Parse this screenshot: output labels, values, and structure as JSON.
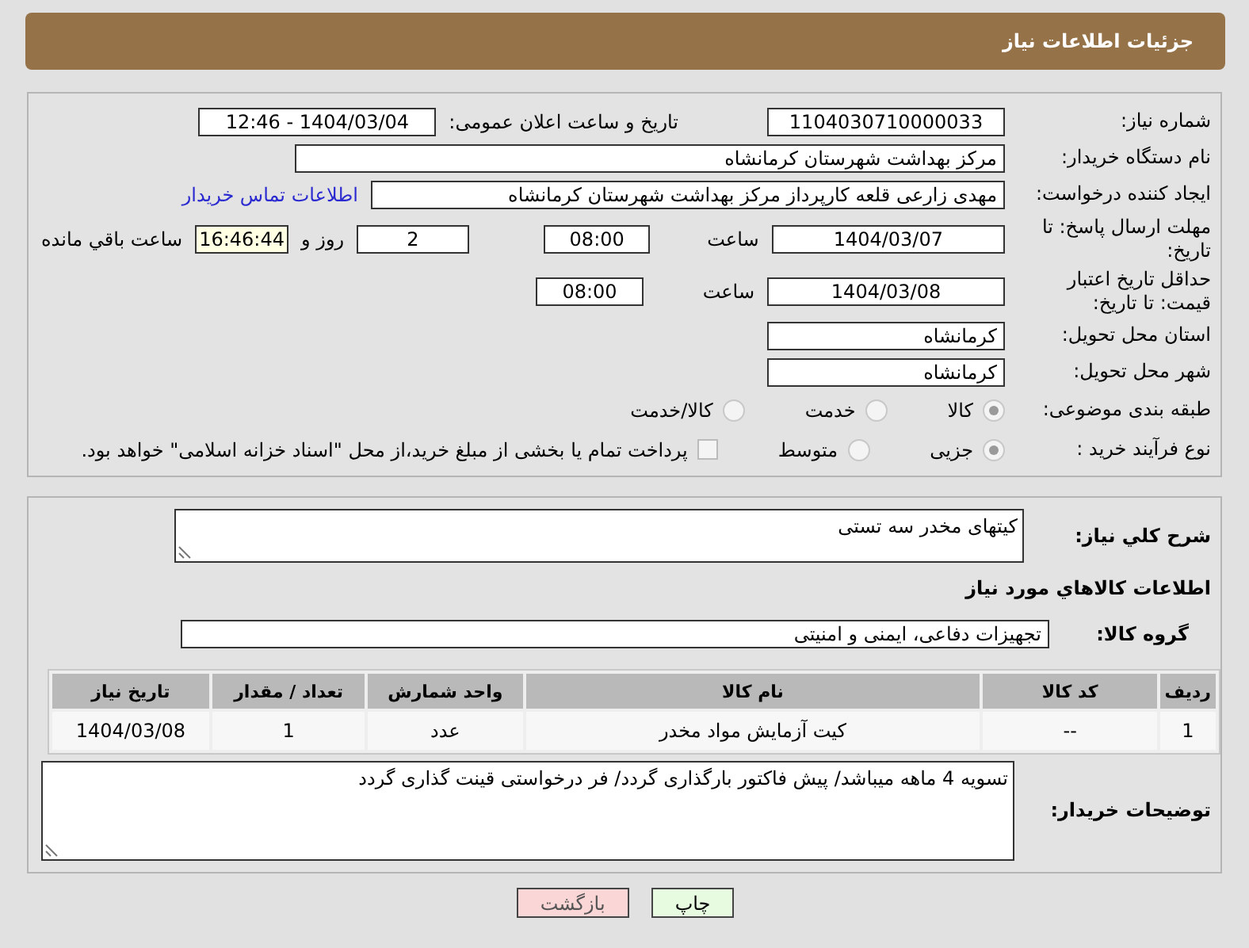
{
  "header": {
    "title": "جزئیات اطلاعات نیاز"
  },
  "need_number": {
    "label": "شماره نیاز:",
    "value": "1104030710000033"
  },
  "announce": {
    "label": "تاریخ و ساعت اعلان عمومی:",
    "value": "1404/03/04 - 12:46"
  },
  "buyer": {
    "label": "نام دستگاه خریدار:",
    "value": "مرکز بهداشت شهرستان کرمانشاه"
  },
  "creator": {
    "label": "ایجاد کننده درخواست:",
    "value": "مهدی  زارعی قلعه کارپرداز مرکز بهداشت شهرستان کرمانشاه",
    "link": "اطلاعات تماس خریدار"
  },
  "deadline": {
    "label": "مهلت ارسال پاسخ: تا تاریخ:",
    "date": "1404/03/07",
    "time_label": "ساعت",
    "time": "08:00",
    "days": "2",
    "days_label": "روز و",
    "remaining": "16:46:44",
    "remaining_label": "ساعت باقي مانده"
  },
  "validity": {
    "label": "حداقل تاریخ اعتبار قیمت: تا تاریخ:",
    "date": "1404/03/08",
    "time_label": "ساعت",
    "time": "08:00"
  },
  "province": {
    "label": "استان محل تحویل:",
    "value": "کرمانشاه"
  },
  "city": {
    "label": "شهر محل تحویل:",
    "value": "کرمانشاه"
  },
  "category": {
    "label": "طبقه بندی موضوعی:",
    "options": [
      {
        "label": "کالا",
        "selected": true
      },
      {
        "label": "خدمت",
        "selected": false
      },
      {
        "label": "کالا/خدمت",
        "selected": false
      }
    ]
  },
  "process": {
    "label": "نوع فرآیند خرید :",
    "options": [
      {
        "label": "جزیی",
        "selected": true
      },
      {
        "label": "متوسط",
        "selected": false
      }
    ],
    "payment": {
      "checked": false,
      "text": "پرداخت تمام یا بخشی از مبلغ خرید،از محل \"اسناد خزانه اسلامی\" خواهد بود."
    }
  },
  "description": {
    "label": "شرح کلي نياز:",
    "value": "کیتهای مخدر سه تستی"
  },
  "goods_heading": "اطلاعات کالاهاي مورد نياز",
  "group": {
    "label": "گروه کالا:",
    "value": "تجهیزات دفاعی، ایمنی و امنیتی"
  },
  "table": {
    "columns": [
      "ردیف",
      "کد کالا",
      "نام کالا",
      "واحد شمارش",
      "تعداد / مقدار",
      "تاریخ نیاز"
    ],
    "rows": [
      [
        "1",
        "--",
        "کیت آزمایش مواد مخدر",
        "عدد",
        "1",
        "1404/03/08"
      ]
    ]
  },
  "notes": {
    "label": "توضیحات خریدار:",
    "value": "تسویه 4 ماهه میباشد/ پیش فاکتور بارگذاری گردد/ فر درخواستی قینت گذاری گردد"
  },
  "buttons": [
    {
      "label": "چاپ",
      "kind": "print"
    },
    {
      "label": "بازگشت",
      "kind": "back"
    }
  ]
}
